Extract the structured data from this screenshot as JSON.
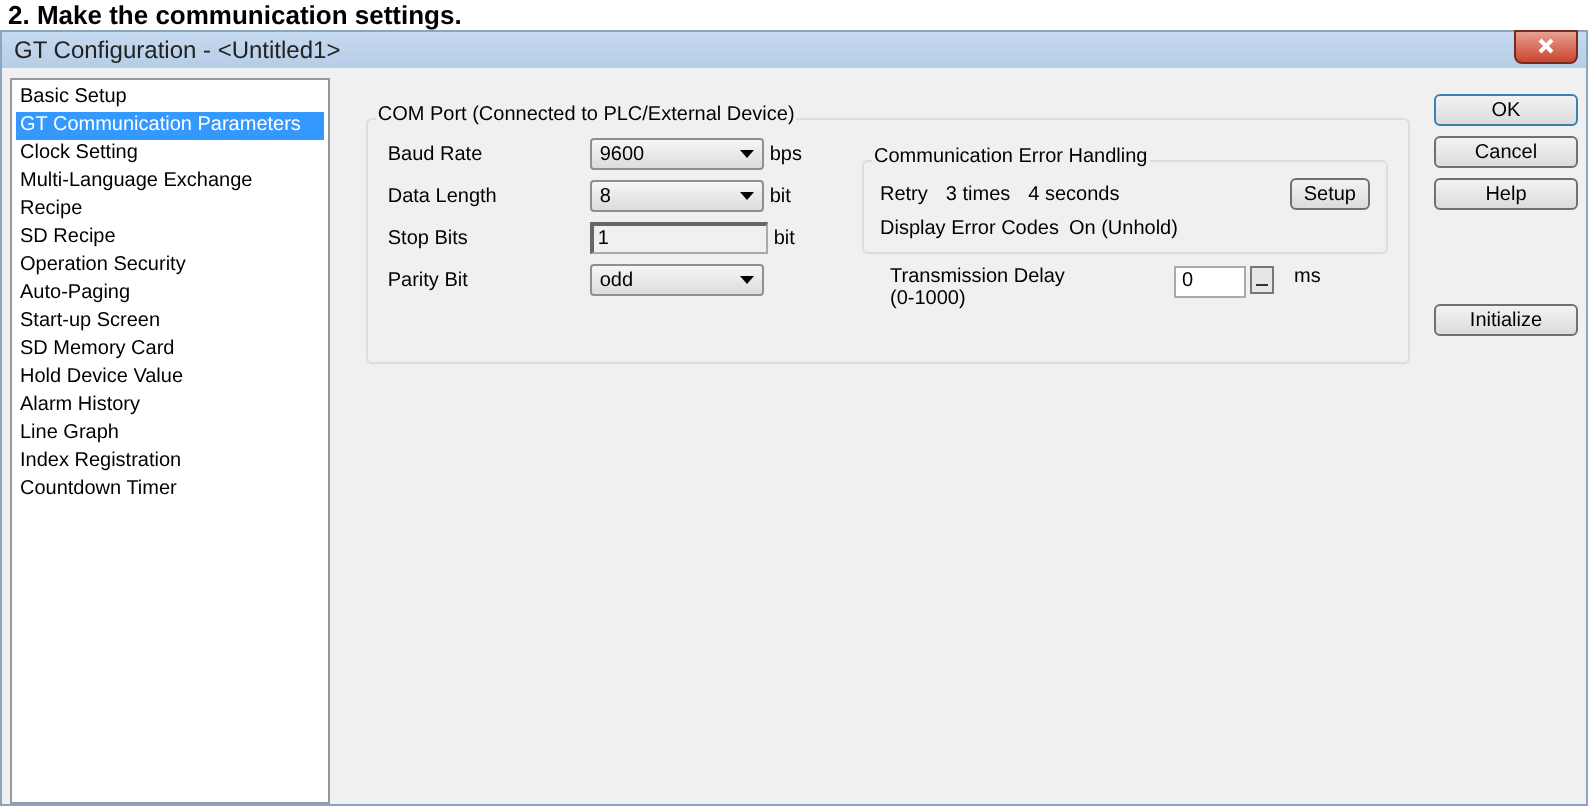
{
  "heading": "2. Make the communication settings.",
  "window": {
    "title": "GT Configuration - <Untitled1>"
  },
  "sidebar": {
    "items": [
      {
        "label": "Basic Setup",
        "selected": false
      },
      {
        "label": "GT Communication Parameters",
        "selected": true
      },
      {
        "label": "Clock Setting",
        "selected": false
      },
      {
        "label": "Multi-Language Exchange",
        "selected": false
      },
      {
        "label": "Recipe",
        "selected": false
      },
      {
        "label": "SD Recipe",
        "selected": false
      },
      {
        "label": "Operation Security",
        "selected": false
      },
      {
        "label": "Auto-Paging",
        "selected": false
      },
      {
        "label": "Start-up Screen",
        "selected": false
      },
      {
        "label": "SD Memory Card",
        "selected": false
      },
      {
        "label": "Hold Device Value",
        "selected": false
      },
      {
        "label": "Alarm History",
        "selected": false
      },
      {
        "label": "Line Graph",
        "selected": false
      },
      {
        "label": "Index Registration",
        "selected": false
      },
      {
        "label": "Countdown Timer",
        "selected": false
      }
    ]
  },
  "com_port": {
    "title": "COM Port (Connected to PLC/External Device)",
    "fields": [
      {
        "kind": "dropdown",
        "label": "Baud Rate",
        "value": "9600",
        "unit": "bps"
      },
      {
        "kind": "dropdown",
        "label": "Data Length",
        "value": "8",
        "unit": "bit"
      },
      {
        "kind": "text",
        "label": "Stop Bits",
        "value": "1",
        "unit": "bit"
      },
      {
        "kind": "dropdown",
        "label": "Parity Bit",
        "value": "odd"
      }
    ]
  },
  "error_handling": {
    "title": "Communication Error Handling",
    "retry_label": "Retry",
    "retry_times": "3 times",
    "retry_seconds": "4 seconds",
    "setup_button": "Setup",
    "codes_label": "Display Error Codes",
    "codes_value": "On (Unhold)"
  },
  "transmission_delay": {
    "label": "Transmission Delay",
    "range": "(0-1000)",
    "value": "0",
    "unit": "ms"
  },
  "buttons": [
    {
      "label": "OK",
      "default": true
    },
    {
      "label": "Cancel",
      "default": false
    },
    {
      "label": "Help",
      "default": false
    }
  ],
  "initialize_button": "Initialize"
}
